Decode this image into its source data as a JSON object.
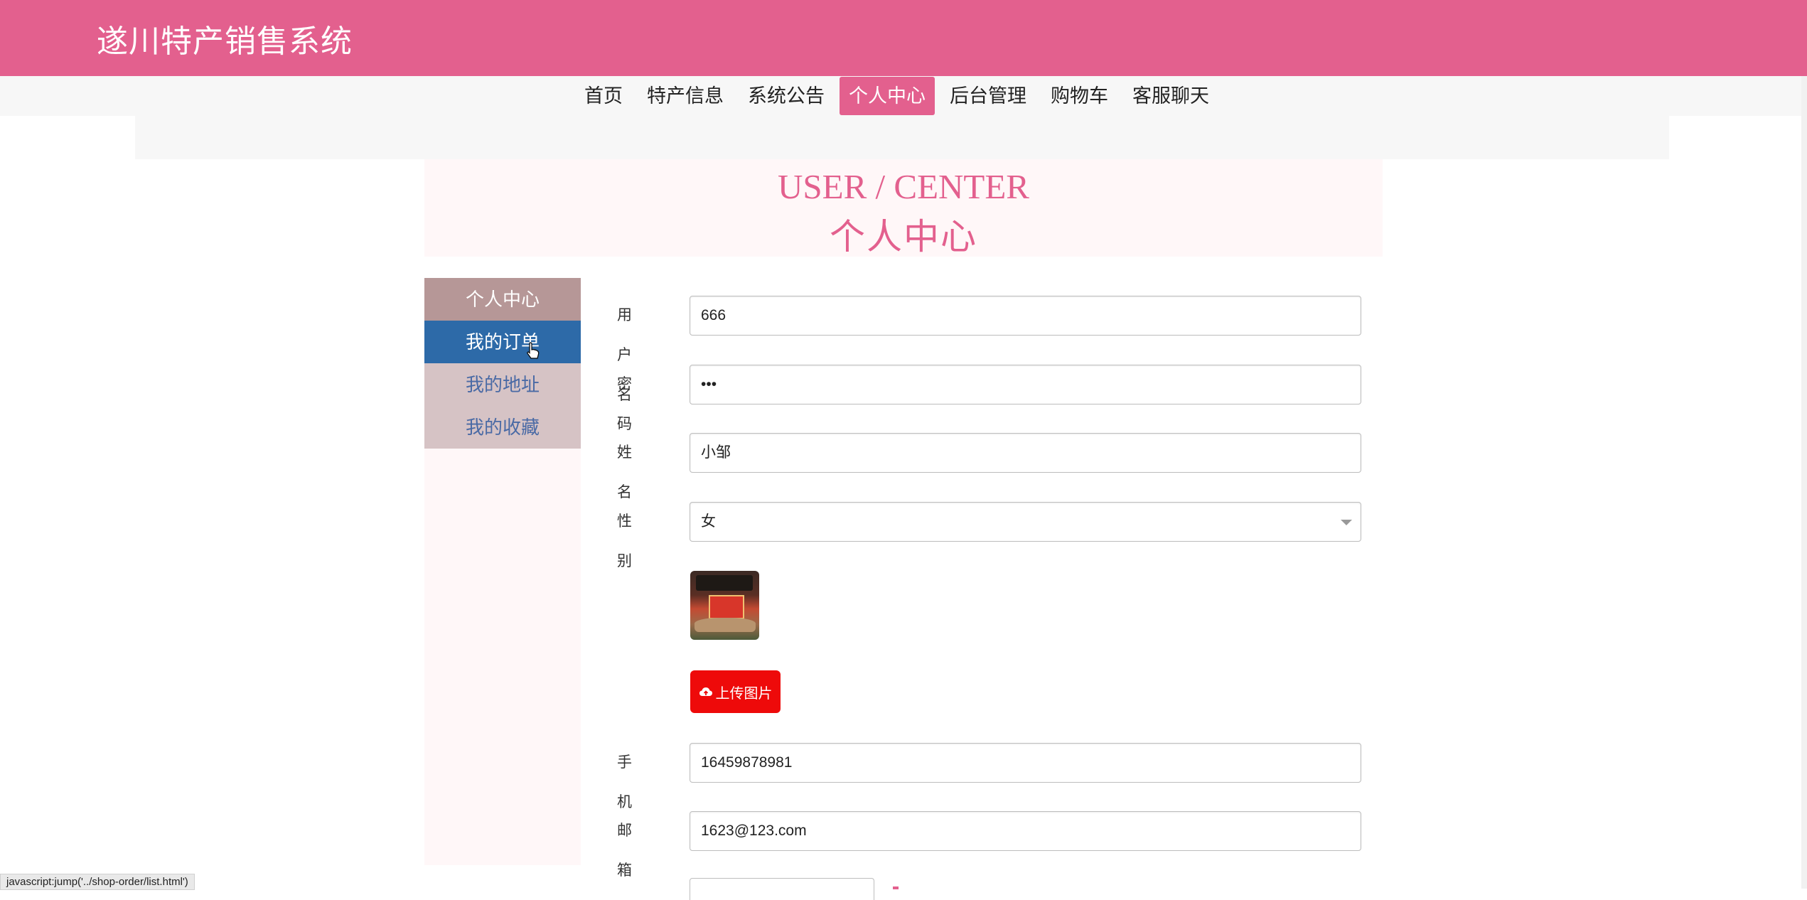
{
  "header": {
    "brand": "遂川特产销售系统"
  },
  "nav": {
    "items": [
      {
        "label": "首页",
        "active": false
      },
      {
        "label": "特产信息",
        "active": false
      },
      {
        "label": "系统公告",
        "active": false
      },
      {
        "label": "个人中心",
        "active": true
      },
      {
        "label": "后台管理",
        "active": false
      },
      {
        "label": "购物车",
        "active": false
      },
      {
        "label": "客服聊天",
        "active": false
      }
    ]
  },
  "hero": {
    "title_en": "USER / CENTER",
    "title_cn": "个人中心"
  },
  "sidebar": {
    "items": [
      {
        "label": "个人中心"
      },
      {
        "label": "我的订单"
      },
      {
        "label": "我的地址"
      },
      {
        "label": "我的收藏"
      }
    ]
  },
  "form": {
    "username": {
      "label": "用户名",
      "value": "666"
    },
    "password": {
      "label": "密码",
      "value": "•••"
    },
    "name": {
      "label": "姓名",
      "value": "小邹"
    },
    "gender": {
      "label": "性别",
      "value": "女"
    },
    "upload_label": "上传图片",
    "phone": {
      "label": "手机",
      "value": "16459878981"
    },
    "email": {
      "label": "邮箱",
      "value": "1623@123.com"
    }
  },
  "statusbar": {
    "text": "javascript:jump('../shop-order/list.html')"
  },
  "colors": {
    "brand": "#e3608e",
    "sidebar_hover": "#2d6aa8",
    "upload": "#ee0a0a"
  },
  "icons": {
    "upload": "cloud-upload-icon",
    "cursor": "hand-cursor-icon"
  }
}
